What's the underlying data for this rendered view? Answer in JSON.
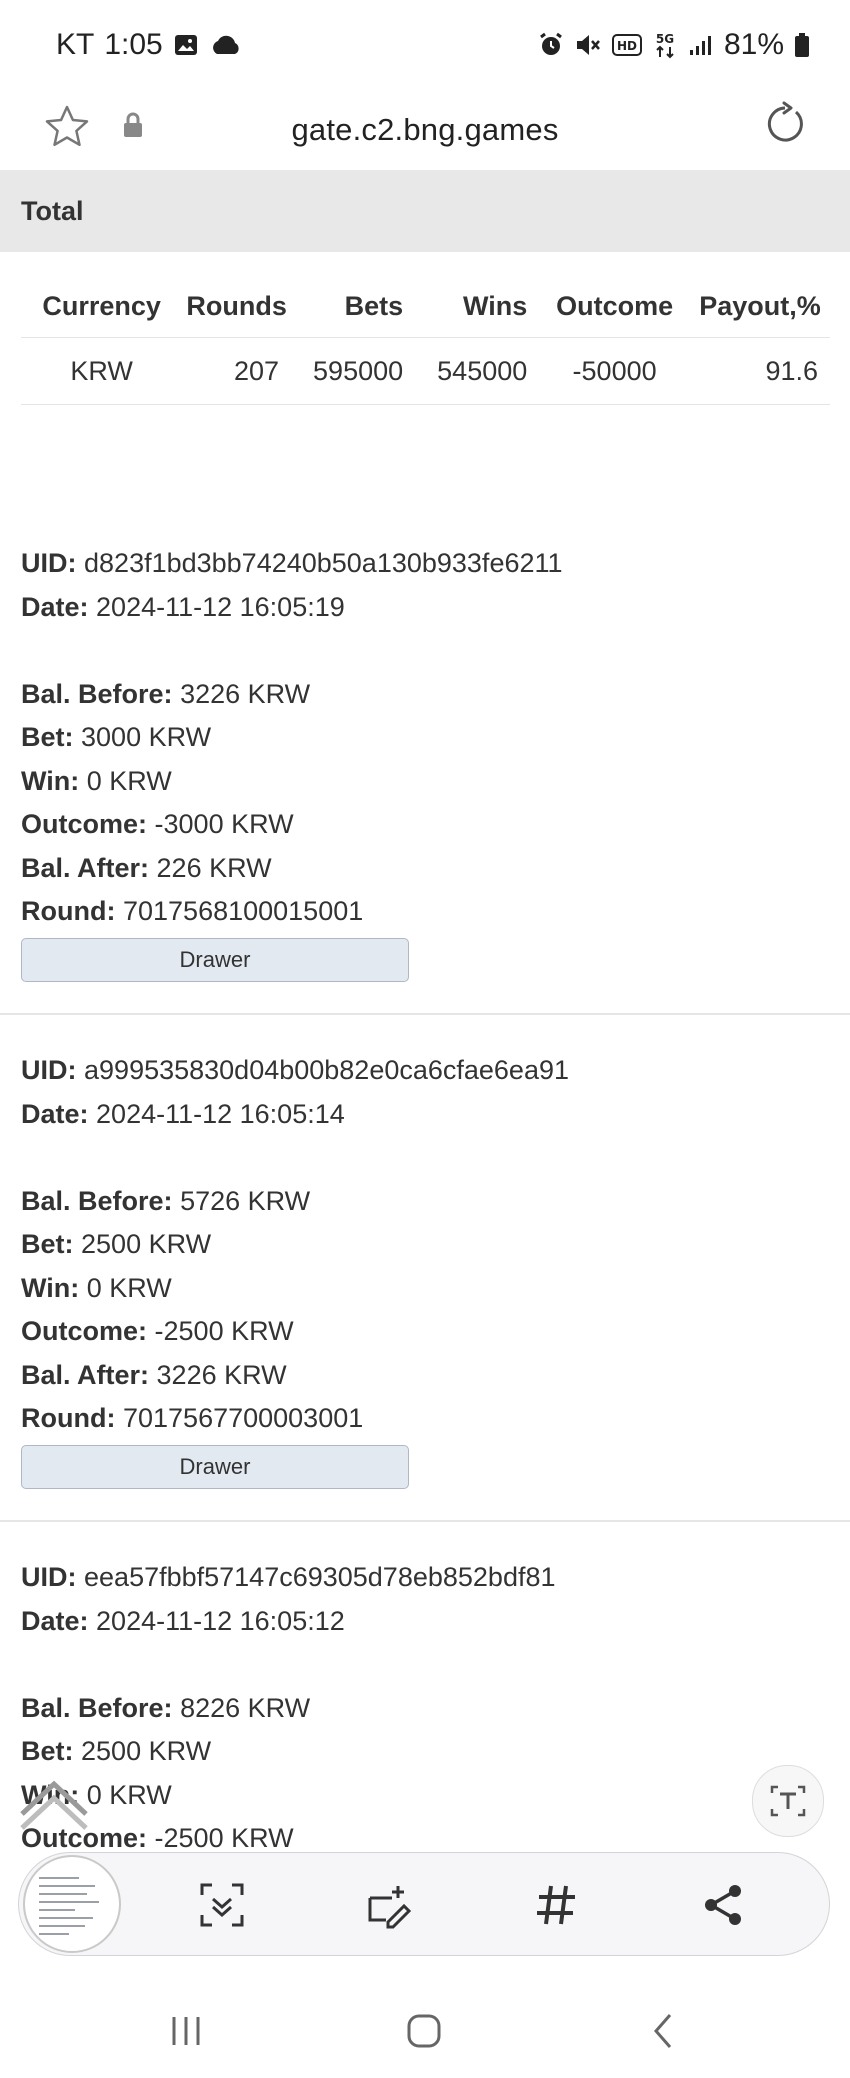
{
  "status": {
    "carrier": "KT",
    "time": "1:05",
    "battery": "81%"
  },
  "browser": {
    "url": "gate.c2.bng.games"
  },
  "total": {
    "title": "Total",
    "headers": [
      "Currency",
      "Rounds",
      "Bets",
      "Wins",
      "Outcome",
      "Payout,%"
    ],
    "row": [
      "KRW",
      "207",
      "595000",
      "545000",
      "-50000",
      "91.6"
    ]
  },
  "labels": {
    "uid": "UID:",
    "date": "Date:",
    "bal_before": "Bal. Before:",
    "bet": "Bet:",
    "win": "Win:",
    "outcome": "Outcome:",
    "bal_after": "Bal. After:",
    "round": "Round:"
  },
  "records": [
    {
      "uid": "d823f1bd3bb74240b50a130b933fe6211",
      "date": "2024-11-12 16:05:19",
      "bal_before": "3226 KRW",
      "bet": "3000 KRW",
      "win": "0 KRW",
      "outcome": "-3000 KRW",
      "bal_after": "226 KRW",
      "round": "7017568100015001",
      "button": "Drawer"
    },
    {
      "uid": "a999535830d04b00b82e0ca6cfae6ea91",
      "date": "2024-11-12 16:05:14",
      "bal_before": "5726 KRW",
      "bet": "2500 KRW",
      "win": "0 KRW",
      "outcome": "-2500 KRW",
      "bal_after": "3226 KRW",
      "round": "7017567700003001",
      "button": "Drawer"
    },
    {
      "uid": "eea57fbbf57147c69305d78eb852bdf81",
      "date": "2024-11-12 16:05:12",
      "bal_before": "8226 KRW",
      "bet": "2500 KRW",
      "win": "0 KRW",
      "outcome": "-2500 KRW"
    }
  ],
  "icons": {
    "status": [
      "gallery-icon",
      "cloud-icon",
      "alarm-icon",
      "mute-icon",
      "hd-icon",
      "5g-icon",
      "signal-icon",
      "battery-icon"
    ],
    "toolbar": [
      "scroll-capture-icon",
      "crop-draw-icon",
      "hashtag-icon",
      "share-icon"
    ],
    "nav": [
      "recents-icon",
      "home-icon",
      "back-icon"
    ]
  }
}
